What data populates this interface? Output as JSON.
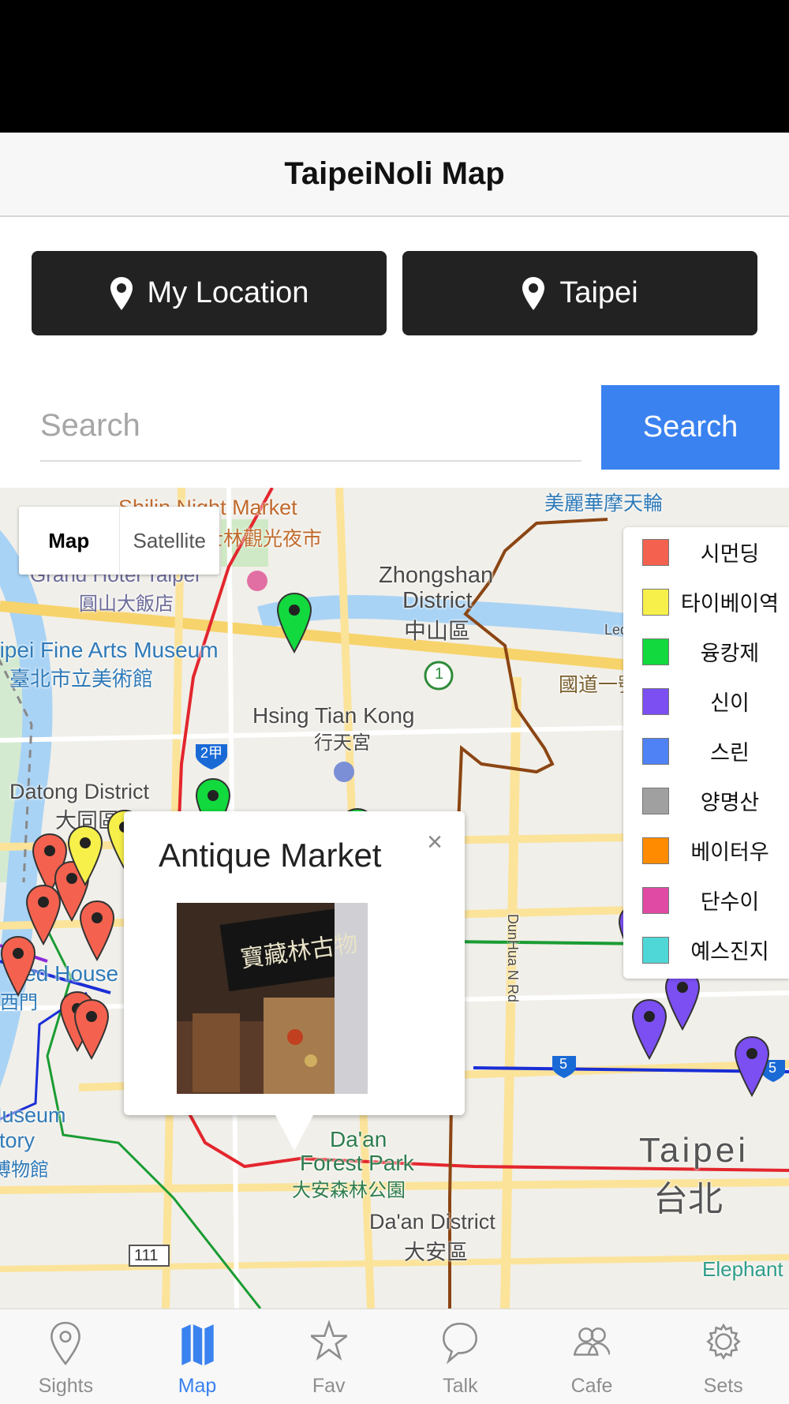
{
  "header": {
    "title": "TaipeiNoli Map"
  },
  "buttons": {
    "my_location": "My Location",
    "taipei": "Taipei"
  },
  "search": {
    "placeholder": "Search",
    "button_label": "Search"
  },
  "map": {
    "type_control": {
      "map": "Map",
      "satellite": "Satellite"
    },
    "labels": {
      "shilin_night_market": "Shilin Night Market",
      "shilin_night_market_zh": "士林觀光夜市",
      "grand_hotel": "Grand Hotel Taipei",
      "grand_hotel_zh": "圓山大飯店",
      "zhongshan": "Zhongshan",
      "district": "District",
      "zhongshan_zh": "中山區",
      "fine_arts": "Taipei Fine Arts Museum",
      "fine_arts_zh": "臺北市立美術館",
      "hsing_tian_kong": "Hsing Tian Kong",
      "hsing_tian_kong_zh": "行天宮",
      "datong": "Datong District",
      "datong_zh": "大同區",
      "miramar": "美麗華摩天輪",
      "national_freeway": "國道一號",
      "lequn": "Lequn",
      "dunhua": "DunHua N Rd",
      "red_house": "Red House",
      "ximen_zh": "西門",
      "museum": "Museum",
      "history": "History",
      "museum_zh": "博物館",
      "daan_park_1": "Da'an",
      "daan_park_2": "Forest Park",
      "daan_park_zh": "大安森林公園",
      "daan_district": "Da'an District",
      "daan_district_zh": "大安區",
      "taipei": "Taipei",
      "taipei_zh": "台北",
      "elephant": "Elephant",
      "road_2a": "2甲",
      "road_1": "1",
      "road_5": "5",
      "road_111": "111"
    },
    "legend": [
      {
        "label": "시먼딩",
        "color": "#f4624f"
      },
      {
        "label": "타이베이역",
        "color": "#f7f04a"
      },
      {
        "label": "융캉제",
        "color": "#12d93d"
      },
      {
        "label": "신이",
        "color": "#7b4ff2"
      },
      {
        "label": "스린",
        "color": "#4f82f5"
      },
      {
        "label": "양명산",
        "color": "#a0a0a0"
      },
      {
        "label": "베이터우",
        "color": "#ff8c00"
      },
      {
        "label": "단수이",
        "color": "#e04aa4"
      },
      {
        "label": "예스진지",
        "color": "#4fd6d6"
      }
    ],
    "info_window": {
      "title": "Antique Market",
      "close": "×",
      "photo_sign": "寶藏林古物"
    }
  },
  "tabs": [
    {
      "label": "Sights",
      "icon": "pin-outline-icon"
    },
    {
      "label": "Map",
      "icon": "map-icon",
      "active": true
    },
    {
      "label": "Fav",
      "icon": "star-icon"
    },
    {
      "label": "Talk",
      "icon": "speech-bubble-icon"
    },
    {
      "label": "Cafe",
      "icon": "people-icon"
    },
    {
      "label": "Sets",
      "icon": "gear-icon"
    }
  ]
}
